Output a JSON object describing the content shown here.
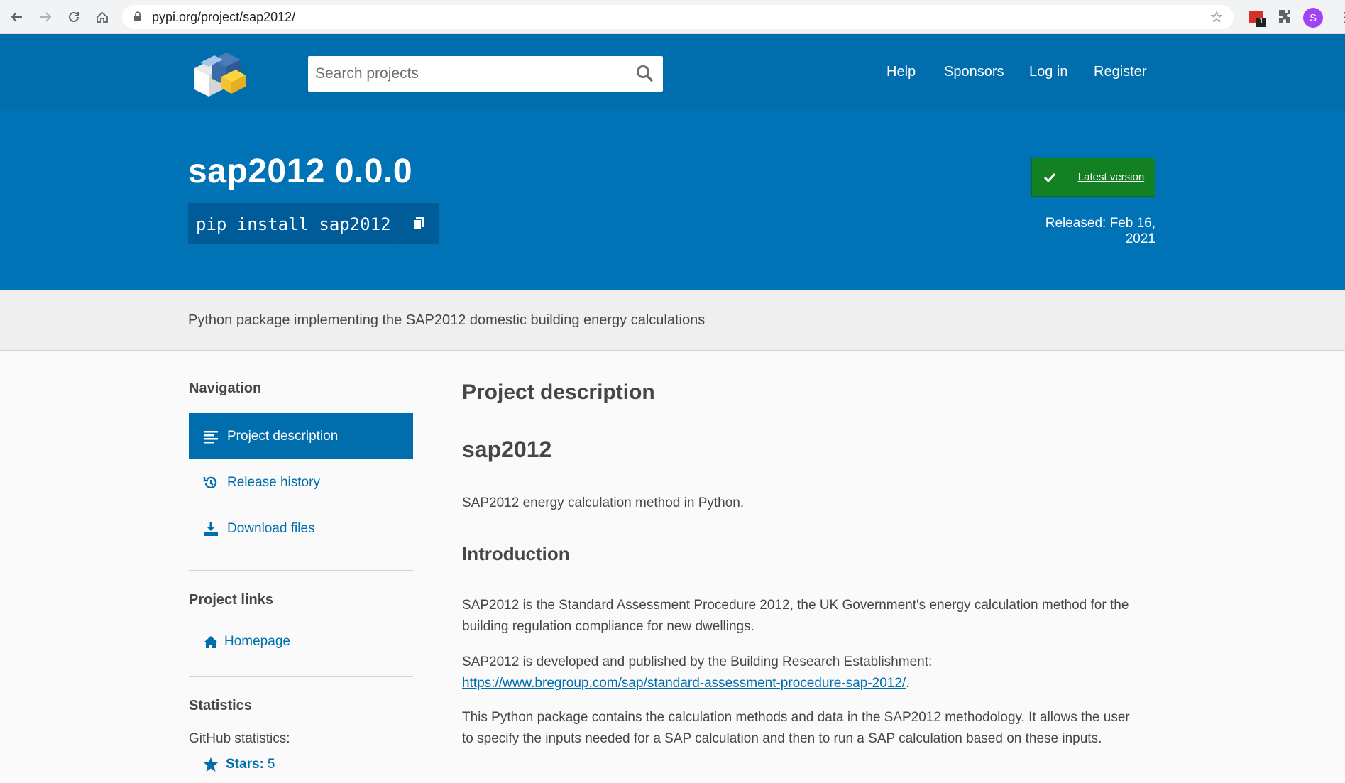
{
  "browser": {
    "url": "pypi.org/project/sap2012/",
    "extension_badge": "1",
    "profile_initial": "S"
  },
  "header": {
    "search_placeholder": "Search projects",
    "nav": [
      "Help",
      "Sponsors",
      "Log in",
      "Register"
    ]
  },
  "package": {
    "title": "sap2012 0.0.0",
    "pip_command": "pip install sap2012",
    "latest_version_label": "Latest version",
    "released": "Released: Feb 16, 2021",
    "summary": "Python package implementing the SAP2012 domestic building energy calculations"
  },
  "sidebar": {
    "navigation_heading": "Navigation",
    "items": [
      {
        "label": "Project description",
        "icon": "align-left-icon",
        "active": true
      },
      {
        "label": "Release history",
        "icon": "history-icon",
        "active": false
      },
      {
        "label": "Download files",
        "icon": "download-icon",
        "active": false
      }
    ],
    "project_links_heading": "Project links",
    "homepage_label": "Homepage",
    "statistics_heading": "Statistics",
    "github_statistics": "GitHub statistics:",
    "stars_label": "Stars:",
    "stars_value": "5"
  },
  "main": {
    "heading": "Project description",
    "readme_title": "sap2012",
    "intro_line": "SAP2012 energy calculation method in Python.",
    "introduction_heading": "Introduction",
    "para1": "SAP2012 is the Standard Assessment Procedure 2012, the UK Government's energy calculation method for the building regulation compliance for new dwellings.",
    "para2_text": "SAP2012 is developed and published by the Building Research Establishment:",
    "para2_link": "https://www.bregroup.com/sap/standard-assessment-procedure-sap-2012/",
    "para2_end": ".",
    "para3": "This Python package contains the calculation methods and data in the SAP2012 methodology. It allows the user to specify the inputs needed for a SAP calculation and then to run a SAP calculation based on these inputs."
  },
  "colors": {
    "header_blue": "#006dad",
    "banner_blue": "#0073b7",
    "latest_green": "#148024"
  }
}
